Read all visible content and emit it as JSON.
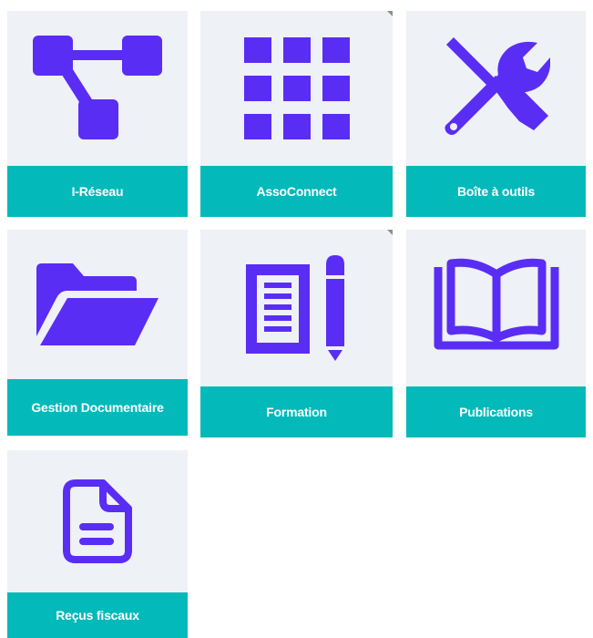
{
  "colors": {
    "accent": "#5a2df5",
    "label_bar": "#04b9ba",
    "tile_bg": "#eef1f5",
    "label_text": "#ffffff"
  },
  "tiles": [
    {
      "label": "I-Réseau",
      "icon": "network-nodes-icon"
    },
    {
      "label": "AssoConnect",
      "icon": "grid-apps-icon"
    },
    {
      "label": "Boîte à outils",
      "icon": "tools-icon"
    },
    {
      "label": "Gestion Documentaire",
      "icon": "folder-open-icon"
    },
    {
      "label": "Formation",
      "icon": "notepad-pencil-icon"
    },
    {
      "label": "Publications",
      "icon": "open-book-icon"
    },
    {
      "label": "Reçus fiscaux",
      "icon": "document-file-icon"
    }
  ]
}
